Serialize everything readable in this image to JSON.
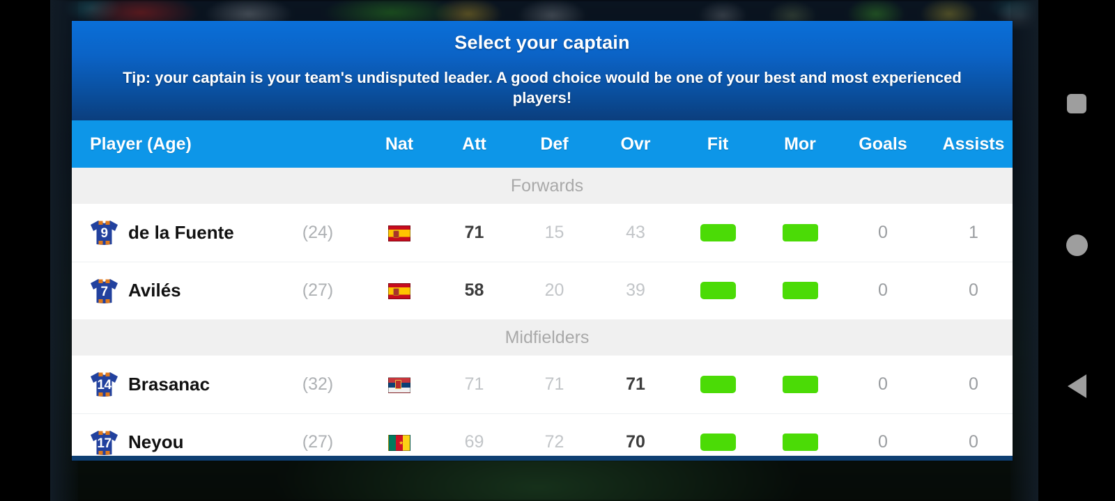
{
  "dialog": {
    "title": "Select your captain",
    "tip": "Tip: your captain is your team's undisputed leader. A good choice would be one of your best and most experienced players!"
  },
  "table": {
    "headers": {
      "player": "Player (Age)",
      "age": "",
      "nat": "Nat",
      "att": "Att",
      "def": "Def",
      "ovr": "Ovr",
      "fit": "Fit",
      "mor": "Mor",
      "goals": "Goals",
      "assists": "Assists"
    },
    "sections": [
      {
        "label": "Forwards",
        "rows": [
          {
            "number": "9",
            "name": "de la Fuente",
            "age": "(24)",
            "nat": "es",
            "att": "71",
            "def": "15",
            "ovr": "43",
            "primary": "att",
            "fit": "full",
            "mor": "full",
            "goals": "0",
            "assists": "1"
          },
          {
            "number": "7",
            "name": "Avilés",
            "age": "(27)",
            "nat": "es",
            "att": "58",
            "def": "20",
            "ovr": "39",
            "primary": "att",
            "fit": "full",
            "mor": "full",
            "goals": "0",
            "assists": "0"
          }
        ]
      },
      {
        "label": "Midfielders",
        "rows": [
          {
            "number": "14",
            "name": "Brasanac",
            "age": "(32)",
            "nat": "rs",
            "att": "71",
            "def": "71",
            "ovr": "71",
            "primary": "ovr",
            "fit": "full",
            "mor": "full",
            "goals": "0",
            "assists": "0"
          },
          {
            "number": "17",
            "name": "Neyou",
            "age": "(27)",
            "nat": "cm",
            "att": "69",
            "def": "72",
            "ovr": "70",
            "primary": "ovr",
            "fit": "full",
            "mor": "full",
            "goals": "0",
            "assists": "0"
          }
        ]
      }
    ]
  },
  "navbar": {
    "recents": "recents-square",
    "home": "home-circle",
    "back": "back-triangle"
  },
  "colors": {
    "header_blue_top": "#0a6fd8",
    "header_blue_bottom": "#0b3e7d",
    "column_header_blue": "#0d96e8",
    "section_gray": "#f0f0f0",
    "bar_green": "#4bdb06",
    "jersey_blue": "#22419e",
    "jersey_trim_orange": "#e07a1c"
  }
}
